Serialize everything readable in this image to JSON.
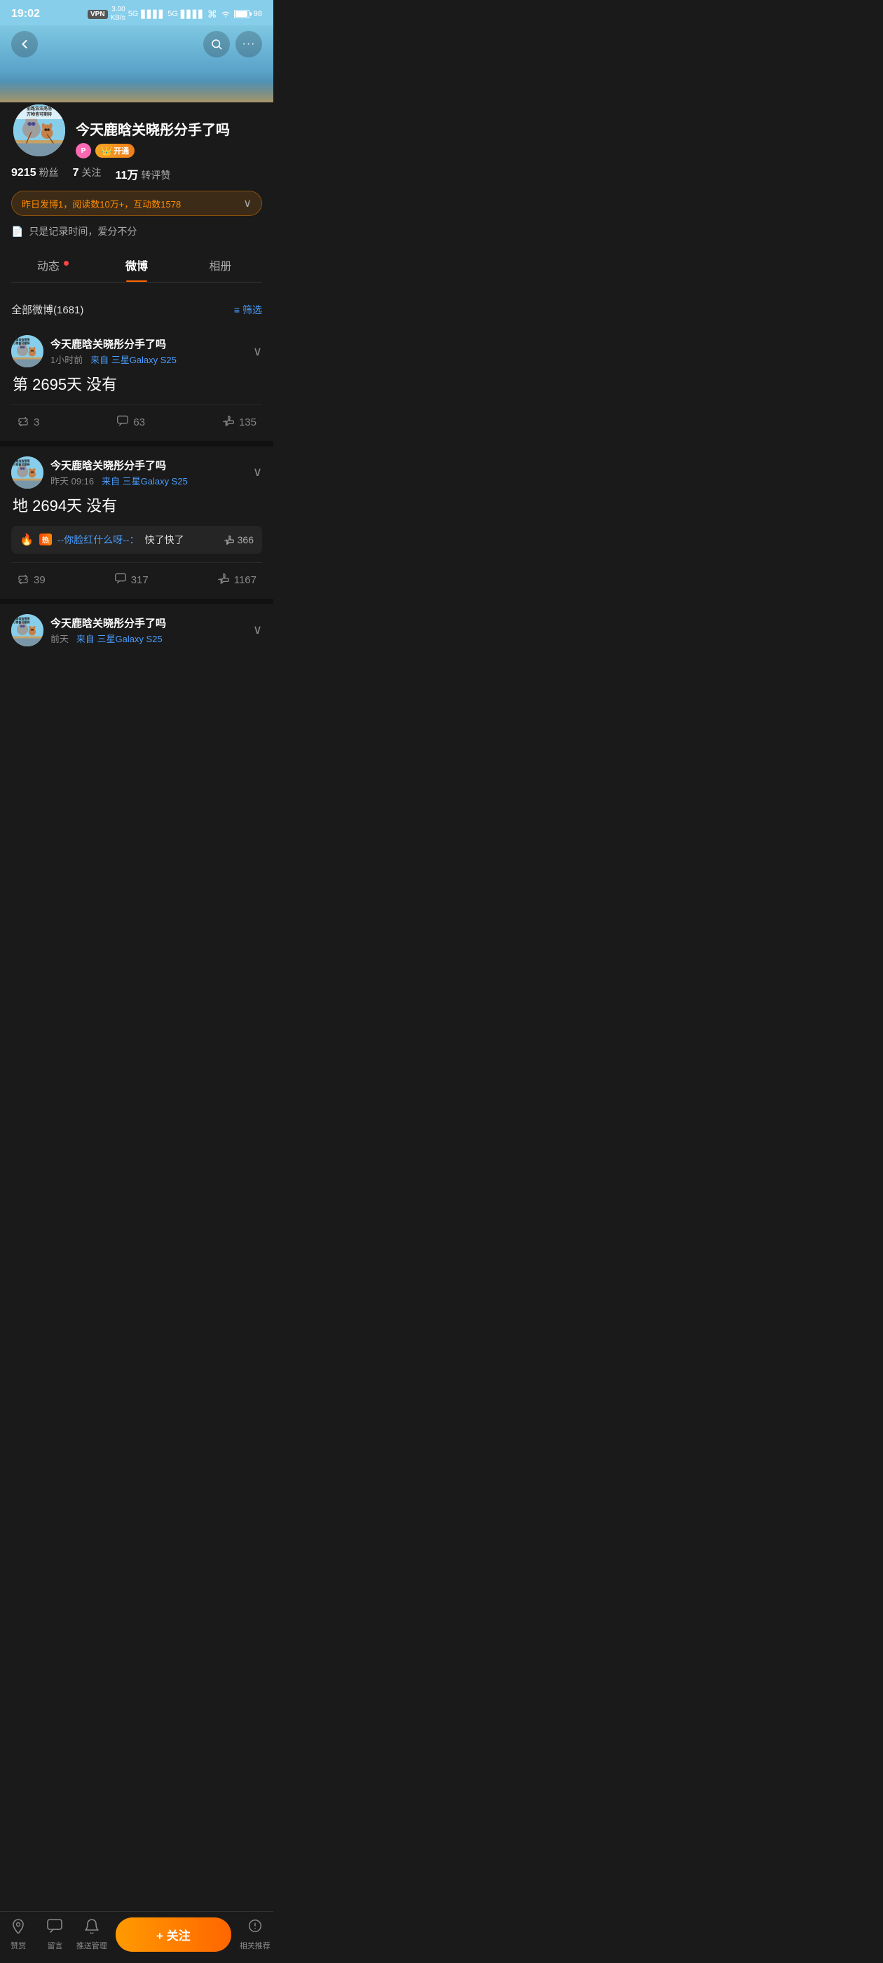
{
  "statusBar": {
    "time": "19:02",
    "vpn": "VPN",
    "speed": "3.00\nKB/s",
    "signal1": "5G",
    "signal2": "5G",
    "battery": "98"
  },
  "nav": {
    "back": "←",
    "search": "🔍",
    "more": "···"
  },
  "profile": {
    "name": "今天鹿晗关晓彤分手了吗",
    "avatarEmoji": "🐱🐭",
    "avatarLabel1": "前路浩浩荡荡",
    "avatarLabel2": "万物皆可期待",
    "stats": {
      "fans": "9215",
      "fans_label": "粉丝",
      "following": "7",
      "following_label": "关注",
      "likes": "11万",
      "likes_label": "转评赞"
    },
    "badge_pink": "P",
    "badge_vip": "开通",
    "notice": "昨日发博1，阅读数10万+，互动数1578",
    "bio_icon": "📄",
    "bio_text": "只是记录时间，爱分不分"
  },
  "tabs": [
    {
      "id": "dongtai",
      "label": "动态",
      "hasDot": true,
      "active": false
    },
    {
      "id": "weibo",
      "label": "微博",
      "hasDot": false,
      "active": true
    },
    {
      "id": "xiangce",
      "label": "相册",
      "hasDot": false,
      "active": false
    }
  ],
  "postListHeader": {
    "countText": "全部微博(1681)",
    "filterLabel": "筛选"
  },
  "posts": [
    {
      "id": "post1",
      "username": "今天鹿晗关晓彤分手了吗",
      "timeAgo": "1小时前",
      "source": "来自 三星Galaxy S25",
      "content": "第 2695天 没有",
      "repost": null,
      "actions": {
        "repost": "3",
        "comment": "63",
        "like": "135"
      }
    },
    {
      "id": "post2",
      "username": "今天鹿晗关晓彤分手了吗",
      "timeAgo": "昨天 09:16",
      "source": "来自 三星Galaxy S25",
      "content": "地 2694天 没有",
      "repost": {
        "hotIcon": "🔥",
        "user": "--你脸红什么呀--：",
        "text": "快了快了",
        "likes": "366"
      },
      "actions": {
        "repost": "39",
        "comment": "317",
        "like": "1167"
      }
    },
    {
      "id": "post3",
      "username": "今天鹿晗关晓彤分手了吗",
      "timeAgo": "前天",
      "source": "来自 三星Galaxy S25",
      "content": "",
      "partial": true,
      "actions": null
    }
  ],
  "bottomBar": {
    "zanshang": "赞赏",
    "liuyan": "留言",
    "tuisong": "推送管理",
    "follow": "+ 关注",
    "tuijian": "相关推荐"
  }
}
